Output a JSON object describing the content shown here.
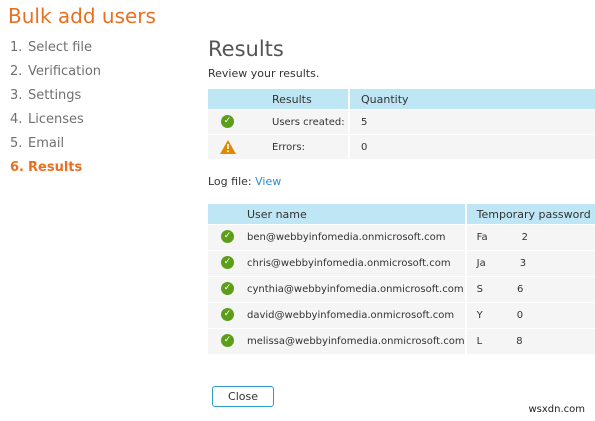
{
  "app_title": "Bulk add users",
  "steps": [
    {
      "num": "1.",
      "label": "Select file"
    },
    {
      "num": "2.",
      "label": "Verification"
    },
    {
      "num": "3.",
      "label": "Settings"
    },
    {
      "num": "4.",
      "label": "Licenses"
    },
    {
      "num": "5.",
      "label": "Email"
    },
    {
      "num": "6.",
      "label": "Results"
    }
  ],
  "main": {
    "title": "Results",
    "subtitle": "Review your results.",
    "summary": {
      "headers": {
        "results": "Results",
        "quantity": "Quantity"
      },
      "rows": [
        {
          "icon": "check-icon",
          "label": "Users created:",
          "value": "5"
        },
        {
          "icon": "warning-icon",
          "label": "Errors:",
          "value": "0"
        }
      ]
    },
    "log": {
      "label": "Log file:",
      "link": "View"
    },
    "users": {
      "headers": {
        "user": "User name",
        "password": "Temporary password"
      },
      "rows": [
        {
          "user": "ben@webbyinfomedia.onmicrosoft.com",
          "pwd_start": "Fa",
          "pwd_end": "2"
        },
        {
          "user": "chris@webbyinfomedia.onmicrosoft.com",
          "pwd_start": "Ja",
          "pwd_end": "3"
        },
        {
          "user": "cynthia@webbyinfomedia.onmicrosoft.com",
          "pwd_start": "S",
          "pwd_end": "6"
        },
        {
          "user": "david@webbyinfomedia.onmicrosoft.com",
          "pwd_start": "Y",
          "pwd_end": "0"
        },
        {
          "user": "melissa@webbyinfomedia.onmicrosoft.com",
          "pwd_start": "L",
          "pwd_end": "8"
        }
      ]
    },
    "close_label": "Close"
  },
  "watermark": "wsxdn.com",
  "colors": {
    "accent_orange": "#eb6f21",
    "header_blue": "#bfe6f5",
    "link_blue": "#2e8ccf",
    "success_green": "#5c9e19",
    "warning_orange": "#e08a00"
  }
}
